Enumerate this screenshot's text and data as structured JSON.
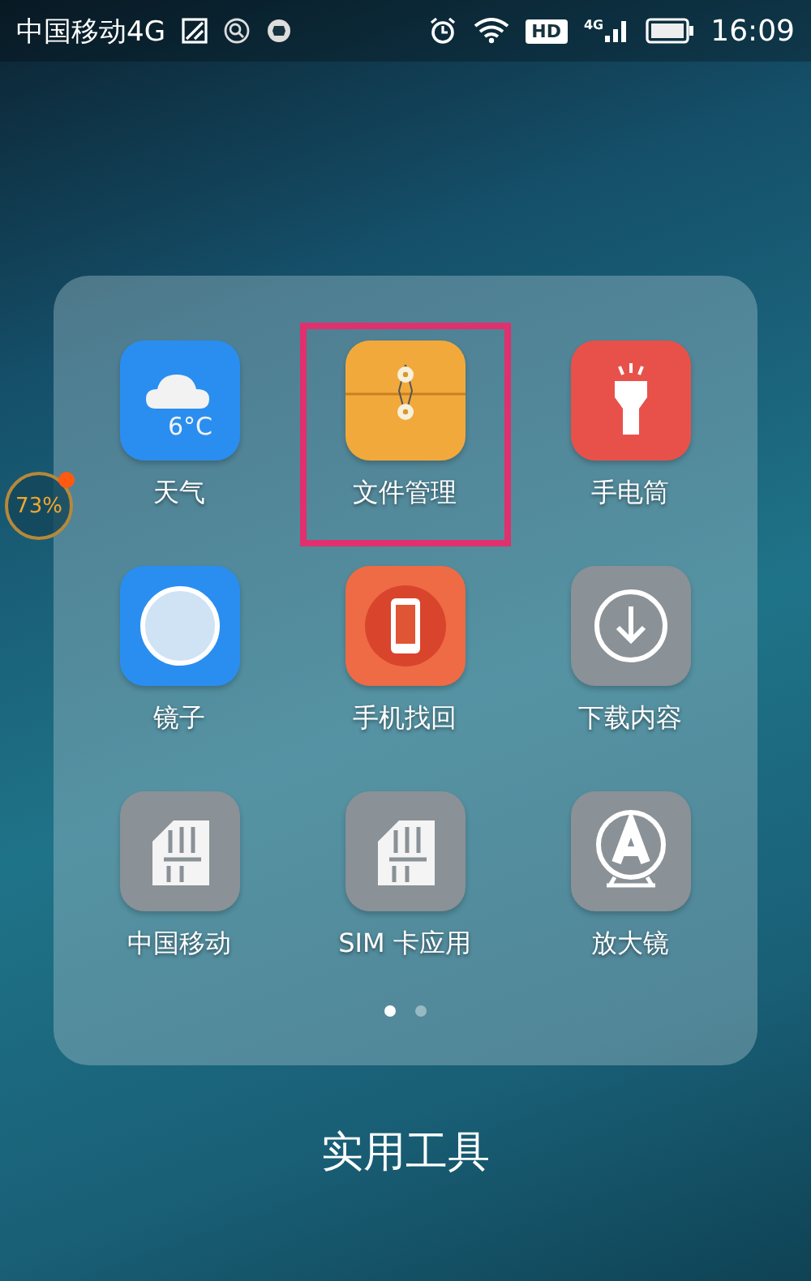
{
  "status_bar": {
    "carrier": "中国移动4G",
    "network": "4G",
    "hd": "HD",
    "time": "16:09"
  },
  "battery_bubble": {
    "text": "73%"
  },
  "folder": {
    "title": "实用工具",
    "apps": [
      {
        "kind": "weather",
        "label": "天气",
        "icon_text": "6°C",
        "highlighted": false
      },
      {
        "kind": "files",
        "label": "文件管理",
        "highlighted": true
      },
      {
        "kind": "flashlight",
        "label": "手电筒",
        "highlighted": false
      },
      {
        "kind": "mirror",
        "label": "镜子",
        "highlighted": false
      },
      {
        "kind": "phone-finder",
        "label": "手机找回",
        "highlighted": false
      },
      {
        "kind": "download",
        "label": "下载内容",
        "highlighted": false
      },
      {
        "kind": "sim",
        "label": "中国移动",
        "highlighted": false
      },
      {
        "kind": "sim",
        "label": "SIM 卡应用",
        "highlighted": false
      },
      {
        "kind": "magnifier",
        "label": "放大镜",
        "highlighted": false
      }
    ],
    "pages": [
      {
        "selected": true
      },
      {
        "selected": false
      }
    ]
  }
}
